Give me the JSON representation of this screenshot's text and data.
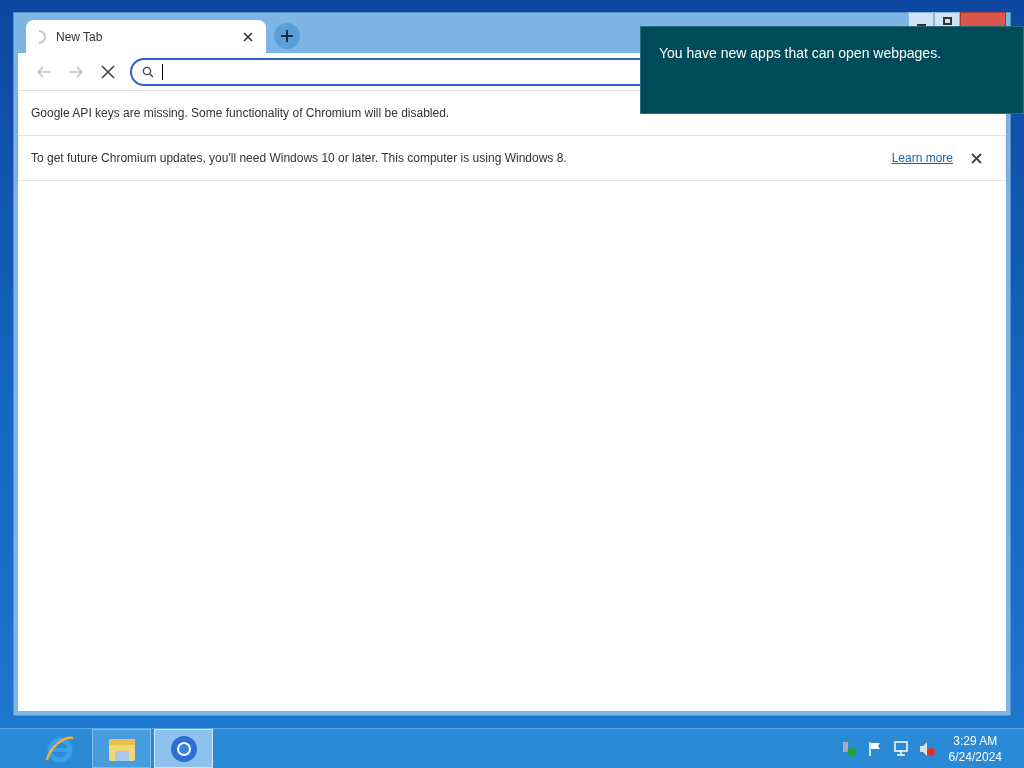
{
  "browser": {
    "tabs": [
      {
        "title": "New Tab",
        "selected": true,
        "loading": true
      }
    ],
    "toolbar": {
      "back_disabled": true,
      "forward_disabled": true,
      "loading": true
    },
    "omnibox": {
      "focused": true
    },
    "infobars": [
      {
        "message": "Google API keys are missing. Some functionality of Chromium will be disabled."
      },
      {
        "message": "To get future Chromium updates, you'll need Windows 10 or later. This computer is using Windows 8.",
        "link": "Learn more",
        "closable": true
      }
    ]
  },
  "toast": {
    "message": "You have new apps that can open webpages."
  },
  "taskbar": {
    "apps": [
      {
        "kind": "ie",
        "active": false
      },
      {
        "kind": "explorer",
        "active": false
      },
      {
        "kind": "chromium",
        "active": true
      }
    ],
    "clock": {
      "time": "3:29 AM",
      "date": "6/24/2024"
    }
  }
}
